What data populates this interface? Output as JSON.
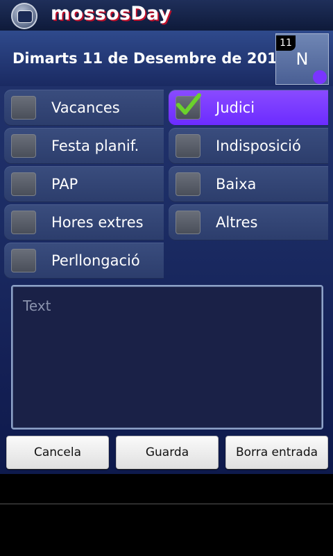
{
  "app": {
    "title": "mossosDay"
  },
  "date": {
    "label": "Dimarts 11 de Desembre de 2012",
    "day_number": "11",
    "day_letter": "N"
  },
  "checkboxes": [
    {
      "label": "Vacances",
      "checked": false
    },
    {
      "label": "Judici",
      "checked": true
    },
    {
      "label": "Festa planif.",
      "checked": false
    },
    {
      "label": "Indisposició",
      "checked": false
    },
    {
      "label": "PAP",
      "checked": false
    },
    {
      "label": "Baixa",
      "checked": false
    },
    {
      "label": "Hores extres",
      "checked": false
    },
    {
      "label": "Altres",
      "checked": false
    },
    {
      "label": "Perllongació",
      "checked": false
    }
  ],
  "text_input": {
    "placeholder": "Text",
    "value": ""
  },
  "buttons": {
    "cancel": "Cancela",
    "save": "Guarda",
    "delete": "Borra entrada"
  },
  "colors": {
    "checked_accent": "#7a35ff",
    "title_shadow": "#c0102a"
  }
}
